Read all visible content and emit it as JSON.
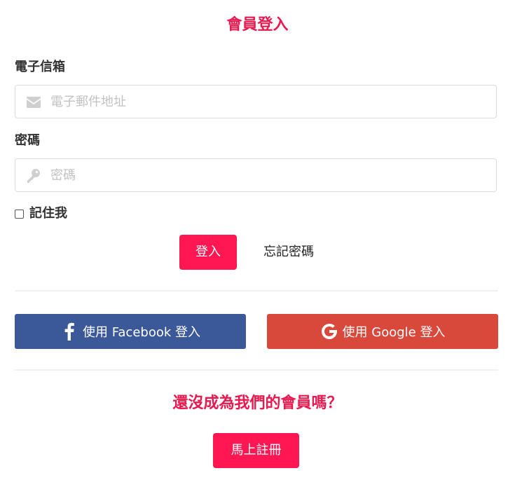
{
  "page": {
    "title": "會員登入"
  },
  "email": {
    "label": "電子信箱",
    "placeholder": "電子郵件地址",
    "icon": "envelope-icon"
  },
  "password": {
    "label": "密碼",
    "placeholder": "密碼",
    "icon": "key-icon"
  },
  "remember": {
    "label": "記住我",
    "checked": false
  },
  "actions": {
    "login_label": "登入",
    "forgot_label": "忘記密碼"
  },
  "social": {
    "facebook_label": "使用 Facebook 登入",
    "facebook_icon": "facebook-icon",
    "google_label": "使用 Google 登入",
    "google_icon": "google-icon"
  },
  "signup": {
    "question": "還沒成為我們的會員嗎？",
    "register_label": "馬上註冊"
  },
  "colors": {
    "accent": "#ff1753",
    "heading": "#e8194f",
    "facebook": "#3b5998",
    "google": "#d9493b"
  }
}
